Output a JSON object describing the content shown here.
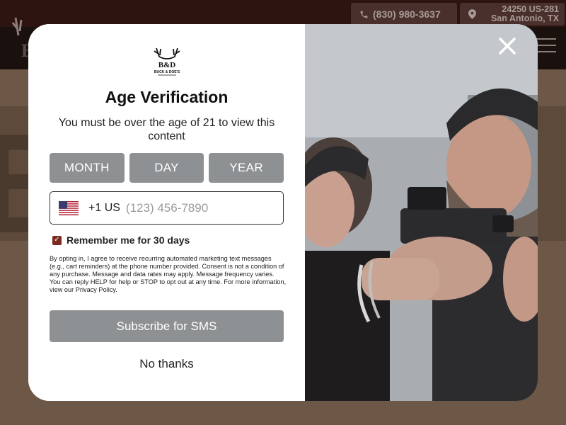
{
  "site": {
    "phone": "(830) 980-3637",
    "address_line1": "24250 US-281",
    "address_line2": "San Antonio, TX"
  },
  "modal": {
    "brand": {
      "logo_text": "B&D",
      "logo_subtext": "BUCK & DOE'S"
    },
    "title": "Age Verification",
    "subtitle": "You must be over the age of 21 to view this content",
    "date_fields": {
      "month_label": "MONTH",
      "day_label": "DAY",
      "year_label": "YEAR"
    },
    "phone": {
      "country_icon": "us-flag-icon",
      "country_code": "+1 US",
      "placeholder": "(123) 456-7890",
      "value": ""
    },
    "remember": {
      "label": "Remember me for 30 days",
      "checked": true
    },
    "legal_text": "By opting in, I agree to receive recurring automated marketing text messages (e.g., cart reminders) at the phone number provided. Consent is not a condition of any purchase. Message and data rates may apply. Message frequency varies. You can reply HELP for help or STOP to opt out at any time. For more information, view our Privacy Policy.",
    "subscribe_label": "Subscribe for SMS",
    "dismiss_label": "No thanks",
    "close_icon": "close-icon"
  },
  "colors": {
    "button_gray": "#8e9193",
    "checkbox_accent": "#7a2a1e",
    "overlay_top_bar": "#2e1410"
  }
}
